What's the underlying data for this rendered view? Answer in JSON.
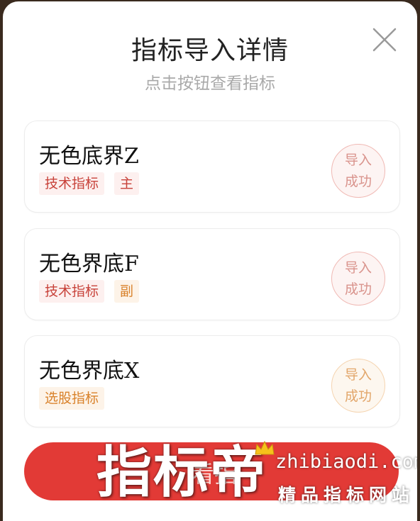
{
  "dialog": {
    "title": "指标导入详情",
    "subtitle": "点击按钮查看指标",
    "close_icon": "close-icon"
  },
  "items": [
    {
      "name": "无色底界Z",
      "tags": [
        {
          "label": "技术指标",
          "color": "red"
        },
        {
          "label": "主",
          "color": "red"
        }
      ],
      "status": [
        "导入",
        "成功"
      ],
      "status_color": "red"
    },
    {
      "name": "无色界底F",
      "tags": [
        {
          "label": "技术指标",
          "color": "red"
        },
        {
          "label": "副",
          "color": "orange"
        }
      ],
      "status": [
        "导入",
        "成功"
      ],
      "status_color": "red"
    },
    {
      "name": "无色界底X",
      "tags": [
        {
          "label": "选股指标",
          "color": "orange"
        }
      ],
      "status": [
        "导入",
        "成功"
      ],
      "status_color": "orange"
    }
  ],
  "action_button": {
    "label": "看指"
  },
  "watermark": {
    "main": "指标帝",
    "domain": "zhibiaodi.com",
    "tagline": "精品指标网站",
    "icon": "crown-icon"
  },
  "colors": {
    "accent": "#e23a36",
    "tag_red": "#c8423a",
    "tag_orange": "#d9822b"
  }
}
